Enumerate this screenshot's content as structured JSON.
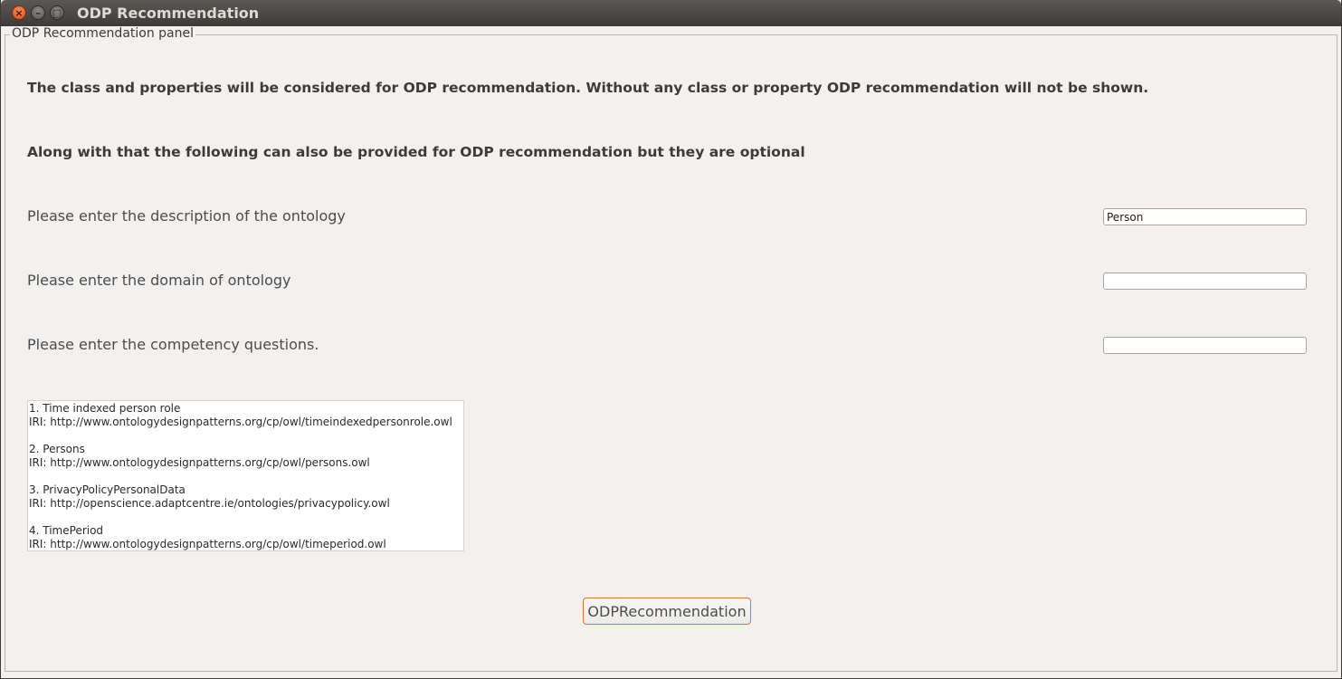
{
  "window": {
    "title": "ODP Recommendation",
    "close_glyph": "×",
    "minimize_glyph": "–",
    "maximize_glyph": "□"
  },
  "panel": {
    "legend": "ODP Recommendation panel",
    "info_line_1": "The class and properties will be considered for ODP recommendation. Without any class or property ODP recommendation will not be shown.",
    "info_line_2": "Along with that the following can also be provided for ODP recommendation but they are optional"
  },
  "fields": {
    "description": {
      "label": "Please enter the description of the ontology",
      "value": "Person"
    },
    "domain": {
      "label": "Please enter the domain of ontology",
      "value": ""
    },
    "competency": {
      "label": "Please enter the competency questions.",
      "value": ""
    }
  },
  "results": [
    {
      "title": "1. Time indexed person role",
      "iri": "IRI: http://www.ontologydesignpatterns.org/cp/owl/timeindexedpersonrole.owl"
    },
    {
      "title": "2. Persons",
      "iri": "IRI: http://www.ontologydesignpatterns.org/cp/owl/persons.owl"
    },
    {
      "title": "3. PrivacyPolicyPersonalData",
      "iri": "IRI: http://openscience.adaptcentre.ie/ontologies/privacypolicy.owl"
    },
    {
      "title": "4. TimePeriod",
      "iri": "IRI: http://www.ontologydesignpatterns.org/cp/owl/timeperiod.owl"
    }
  ],
  "actions": {
    "recommend_label": "ODPRecommendation"
  },
  "colors": {
    "titlebar": "#3c3b37",
    "close_button": "#df4a16",
    "button_border": "#e0703f",
    "background": "#f2f1f0"
  },
  "icons": {
    "close": "close-icon",
    "minimize": "minimize-icon",
    "maximize": "maximize-icon"
  }
}
